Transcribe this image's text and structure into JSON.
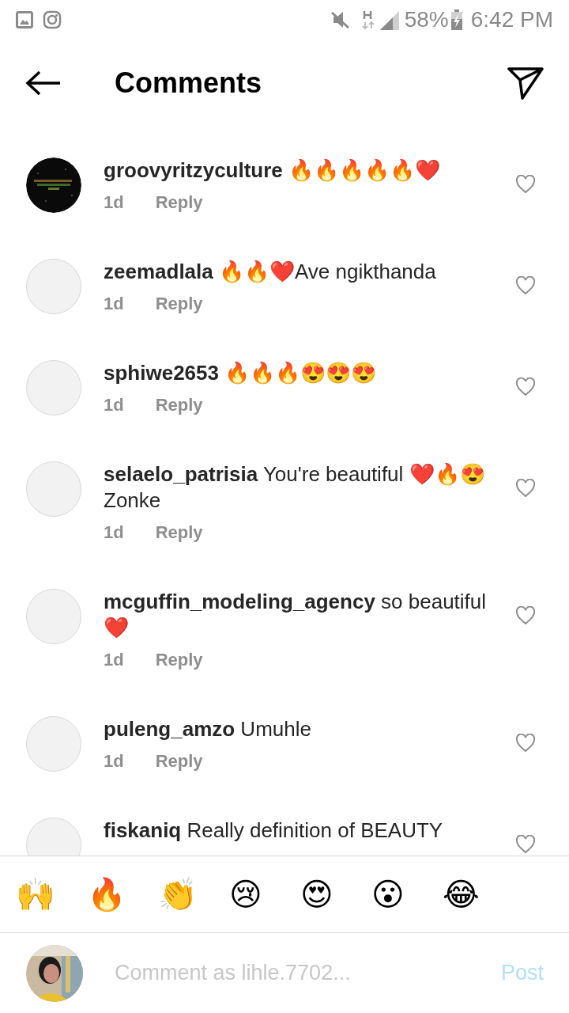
{
  "status_bar": {
    "battery": "58%",
    "time": "6:42 PM"
  },
  "header": {
    "title": "Comments"
  },
  "comments": [
    {
      "username": "groovyritzyculture",
      "text": "🔥🔥🔥🔥🔥❤️",
      "time": "1d",
      "reply": "Reply"
    },
    {
      "username": "zeemadlala",
      "text": "🔥🔥❤️Ave ngikthanda",
      "time": "1d",
      "reply": "Reply",
      "kind": "plain"
    },
    {
      "username": "sphiwe2653",
      "text": "🔥🔥🔥😍😍😍",
      "time": "1d",
      "reply": "Reply",
      "kind": "plain"
    },
    {
      "username": "selaelo_patrisia",
      "text": "You're beautiful ❤️🔥😍Zonke",
      "time": "1d",
      "reply": "Reply",
      "kind": "plain"
    },
    {
      "username": "mcguffin_modeling_agency",
      "text": "so beautiful ❤️",
      "time": "1d",
      "reply": "Reply",
      "kind": "plain"
    },
    {
      "username": "puleng_amzo",
      "text": "Umuhle",
      "time": "1d",
      "reply": "Reply",
      "kind": "plain"
    },
    {
      "username": "fiskaniq",
      "text": "Really definition of BEAUTY",
      "kind": "plain"
    }
  ],
  "quick_emojis": [
    "🙌",
    "🔥",
    "👏",
    "😢",
    "😍",
    "😮",
    "😂"
  ],
  "composer": {
    "placeholder": "Comment as lihle.7702...",
    "post": "Post"
  }
}
